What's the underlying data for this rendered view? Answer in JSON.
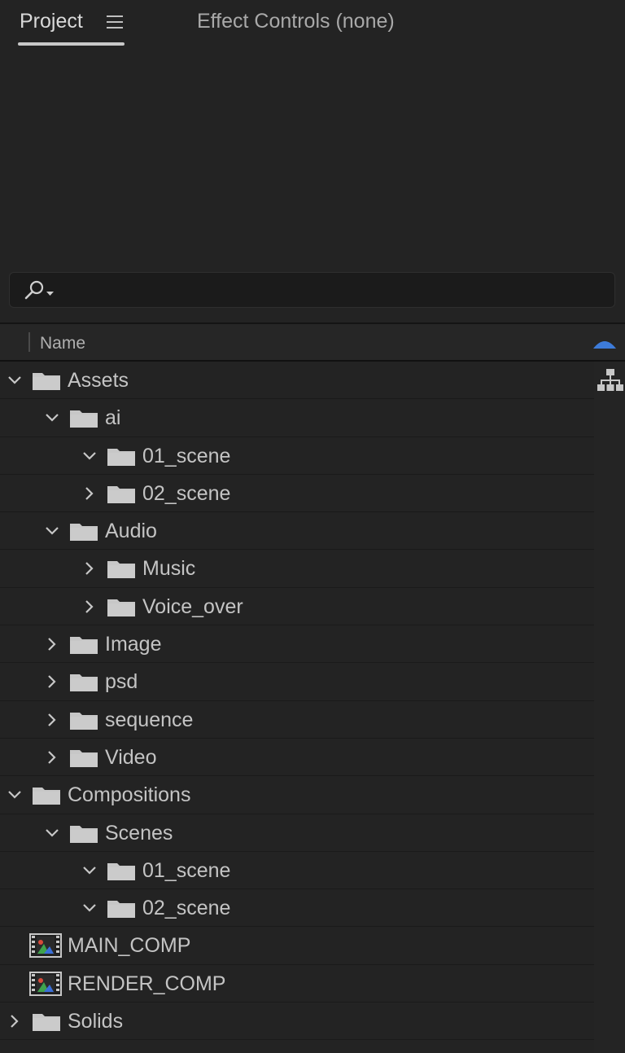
{
  "tabs": {
    "project_label": "Project",
    "effect_controls_label": "Effect Controls (none)"
  },
  "search": {
    "placeholder": "",
    "value": ""
  },
  "columns": {
    "name_header": "Name"
  },
  "tree": [
    {
      "label": "Assets",
      "depth": 0,
      "type": "folder",
      "expanded": true
    },
    {
      "label": "ai",
      "depth": 1,
      "type": "folder",
      "expanded": true
    },
    {
      "label": "01_scene",
      "depth": 2,
      "type": "folder",
      "expanded": true
    },
    {
      "label": "02_scene",
      "depth": 2,
      "type": "folder",
      "expanded": false
    },
    {
      "label": "Audio",
      "depth": 1,
      "type": "folder",
      "expanded": true
    },
    {
      "label": "Music",
      "depth": 2,
      "type": "folder",
      "expanded": false
    },
    {
      "label": "Voice_over",
      "depth": 2,
      "type": "folder",
      "expanded": false
    },
    {
      "label": "Image",
      "depth": 1,
      "type": "folder",
      "expanded": false
    },
    {
      "label": "psd",
      "depth": 1,
      "type": "folder",
      "expanded": false
    },
    {
      "label": "sequence",
      "depth": 1,
      "type": "folder",
      "expanded": false
    },
    {
      "label": "Video",
      "depth": 1,
      "type": "folder",
      "expanded": false
    },
    {
      "label": "Compositions",
      "depth": 0,
      "type": "folder",
      "expanded": true
    },
    {
      "label": "Scenes",
      "depth": 1,
      "type": "folder",
      "expanded": true
    },
    {
      "label": "01_scene",
      "depth": 2,
      "type": "folder",
      "expanded": true
    },
    {
      "label": "02_scene",
      "depth": 2,
      "type": "folder",
      "expanded": true
    },
    {
      "label": "MAIN_COMP",
      "depth": 0,
      "type": "composition"
    },
    {
      "label": "RENDER_COMP",
      "depth": 0,
      "type": "composition"
    },
    {
      "label": "Solids",
      "depth": 0,
      "type": "folder",
      "expanded": false
    }
  ],
  "colors": {
    "panel_bg": "#232323",
    "accent_sort_arrow": "#3d7bd9",
    "folder_icon": "#c7c7c7",
    "text": "#c4c4c4"
  },
  "icons": {
    "menu": "hamburger-icon",
    "search": "search-icon",
    "sort": "sort-ascending-icon",
    "flowchart": "flowchart-icon",
    "folder": "folder-icon",
    "composition": "composition-icon"
  }
}
